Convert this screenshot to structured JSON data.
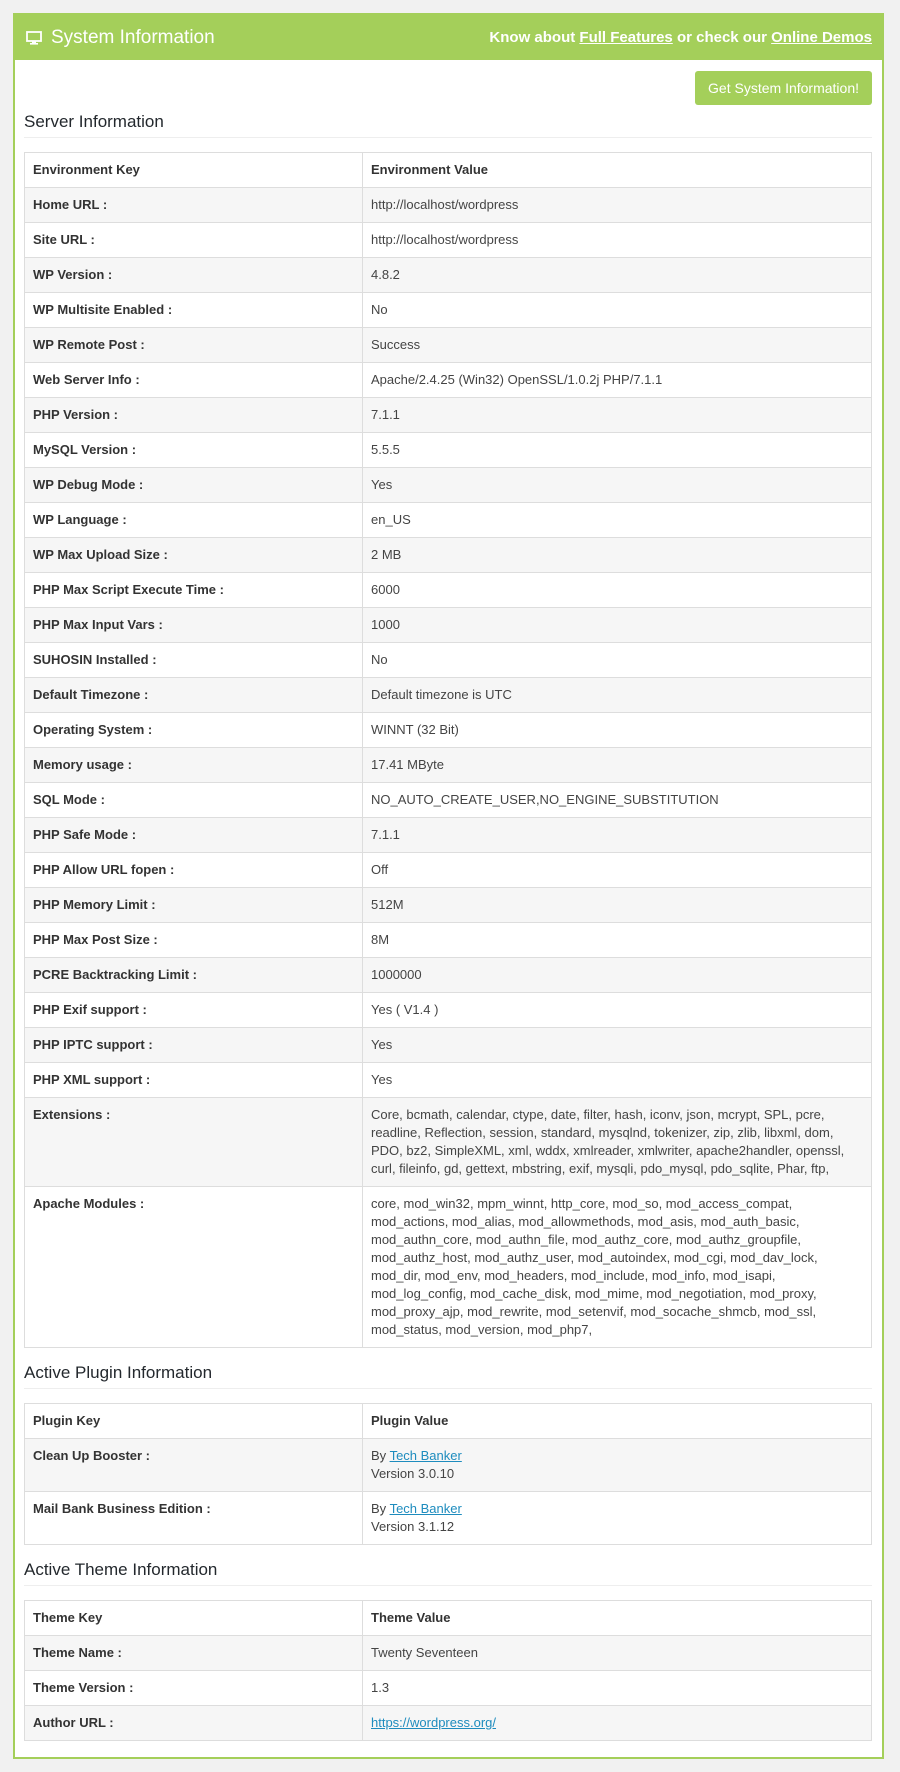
{
  "header": {
    "title": "System Information",
    "prefix": "Know about",
    "link1": "Full Features",
    "middle": "or check our",
    "link2": "Online Demos"
  },
  "button_label": "Get System Information!",
  "server": {
    "title": "Server Information",
    "key_header": "Environment Key",
    "value_header": "Environment Value",
    "rows": [
      [
        "Home URL :",
        "http://localhost/wordpress"
      ],
      [
        "Site URL :",
        "http://localhost/wordpress"
      ],
      [
        "WP Version :",
        "4.8.2"
      ],
      [
        "WP Multisite Enabled :",
        "No"
      ],
      [
        "WP Remote Post :",
        "Success"
      ],
      [
        "Web Server Info :",
        "Apache/2.4.25 (Win32) OpenSSL/1.0.2j PHP/7.1.1"
      ],
      [
        "PHP Version :",
        "7.1.1"
      ],
      [
        "MySQL Version :",
        "5.5.5"
      ],
      [
        "WP Debug Mode :",
        "Yes"
      ],
      [
        "WP Language :",
        "en_US"
      ],
      [
        "WP Max Upload Size :",
        "2 MB"
      ],
      [
        "PHP Max Script Execute Time :",
        "6000"
      ],
      [
        "PHP Max Input Vars :",
        "1000"
      ],
      [
        "SUHOSIN Installed :",
        "No"
      ],
      [
        "Default Timezone :",
        "Default timezone is UTC"
      ],
      [
        "Operating System :",
        "WINNT (32 Bit)"
      ],
      [
        "Memory usage :",
        "17.41 MByte"
      ],
      [
        "SQL Mode :",
        "NO_AUTO_CREATE_USER,NO_ENGINE_SUBSTITUTION"
      ],
      [
        "PHP Safe Mode :",
        "7.1.1"
      ],
      [
        "PHP Allow URL fopen :",
        "Off"
      ],
      [
        "PHP Memory Limit :",
        "512M"
      ],
      [
        "PHP Max Post Size :",
        "8M"
      ],
      [
        "PCRE Backtracking Limit :",
        "1000000"
      ],
      [
        "PHP Exif support :",
        "Yes ( V1.4 )"
      ],
      [
        "PHP IPTC support :",
        "Yes"
      ],
      [
        "PHP XML support :",
        "Yes"
      ],
      [
        "Extensions :",
        "Core, bcmath, calendar, ctype, date, filter, hash, iconv, json, mcrypt, SPL, pcre, readline, Reflection, session, standard, mysqlnd, tokenizer, zip, zlib, libxml, dom, PDO, bz2, SimpleXML, xml, wddx, xmlreader, xmlwriter, apache2handler, openssl, curl, fileinfo, gd, gettext, mbstring, exif, mysqli, pdo_mysql, pdo_sqlite, Phar, ftp,"
      ],
      [
        "Apache Modules :",
        "core, mod_win32, mpm_winnt, http_core, mod_so, mod_access_compat, mod_actions, mod_alias, mod_allowmethods, mod_asis, mod_auth_basic, mod_authn_core, mod_authn_file, mod_authz_core, mod_authz_groupfile, mod_authz_host, mod_authz_user, mod_autoindex, mod_cgi, mod_dav_lock, mod_dir, mod_env, mod_headers, mod_include, mod_info, mod_isapi, mod_log_config, mod_cache_disk, mod_mime, mod_negotiation, mod_proxy, mod_proxy_ajp, mod_rewrite, mod_setenvif, mod_socache_shmcb, mod_ssl, mod_status, mod_version, mod_php7,"
      ]
    ]
  },
  "plugins": {
    "title": "Active Plugin Information",
    "key_header": "Plugin Key",
    "value_header": "Plugin Value",
    "by": "By",
    "items": [
      {
        "name": "Clean Up Booster :",
        "author": "Tech Banker",
        "version": "Version 3.0.10"
      },
      {
        "name": "Mail Bank Business Edition :",
        "author": "Tech Banker",
        "version": "Version 3.1.12"
      }
    ]
  },
  "theme": {
    "title": "Active Theme Information",
    "key_header": "Theme Key",
    "value_header": "Theme Value",
    "name_label": "Theme Name :",
    "name_value": "Twenty Seventeen",
    "version_label": "Theme Version :",
    "version_value": "1.3",
    "author_label": "Author URL :",
    "author_value": "https://wordpress.org/"
  },
  "colors": {
    "accent": "#a4cf5a",
    "link": "#1e8cbe"
  }
}
